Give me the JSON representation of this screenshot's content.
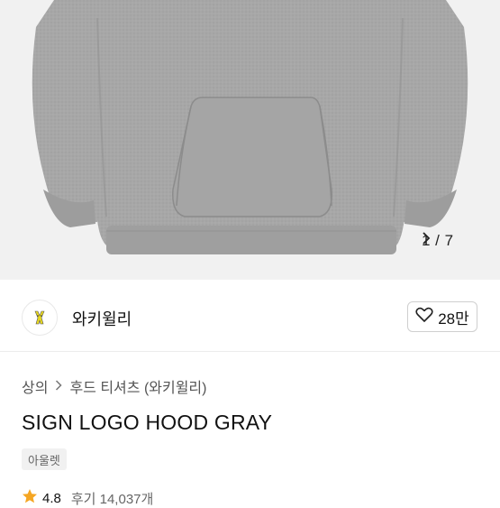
{
  "gallery": {
    "counter": "1 / 7",
    "next_icon": "chevron-right-icon"
  },
  "brand": {
    "name": "와키윌리",
    "logo_icon": "wakiwilly-logo-icon",
    "like_icon": "heart-outline-icon",
    "likes": "28만"
  },
  "breadcrumb": {
    "items": [
      "상의",
      "후드 티셔츠 (와키윌리)"
    ],
    "separator_icon": "chevron-right-icon"
  },
  "product": {
    "title": "SIGN LOGO HOOD GRAY",
    "tag": "아울렛"
  },
  "rating": {
    "star_icon": "star-icon",
    "value": "4.8",
    "reviews": "후기 14,037개"
  },
  "colors": {
    "hoodie": "#a6a6a6",
    "background": "#f1f1f1",
    "star": "#f5a623",
    "logo_yellow": "#e9d91f"
  }
}
